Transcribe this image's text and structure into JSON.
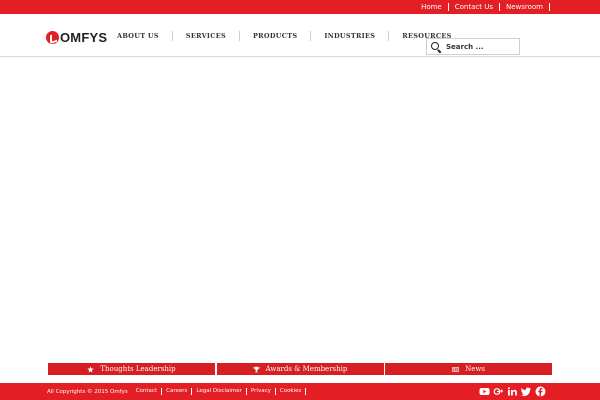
{
  "topbar": {
    "links": [
      "Home",
      "Contact Us",
      "Newsroom"
    ]
  },
  "header": {
    "logo_text": "OMFYS",
    "nav": [
      "ABOUT US",
      "SERVICES",
      "PRODUCTS",
      "INDUSTRIES",
      "RESOURCES"
    ],
    "search": {
      "placeholder": "Search ..."
    }
  },
  "tabs": [
    {
      "label": "Thoughts Leadership",
      "icon": "star-icon"
    },
    {
      "label": "Awards & Membership",
      "icon": "trophy-icon"
    },
    {
      "label": "News",
      "icon": "newspaper-icon"
    }
  ],
  "footer": {
    "copyright": "All Copyrights © 2015 Omfys",
    "links": [
      "Contact",
      "Careers",
      "Legal Disclaimer",
      "Privacy",
      "Cookies"
    ],
    "social": [
      "youtube-icon",
      "google-plus-icon",
      "linkedin-icon",
      "twitter-icon",
      "facebook-icon"
    ]
  },
  "colors": {
    "brand_red": "#e31e24",
    "tab_red": "#d61e23"
  }
}
